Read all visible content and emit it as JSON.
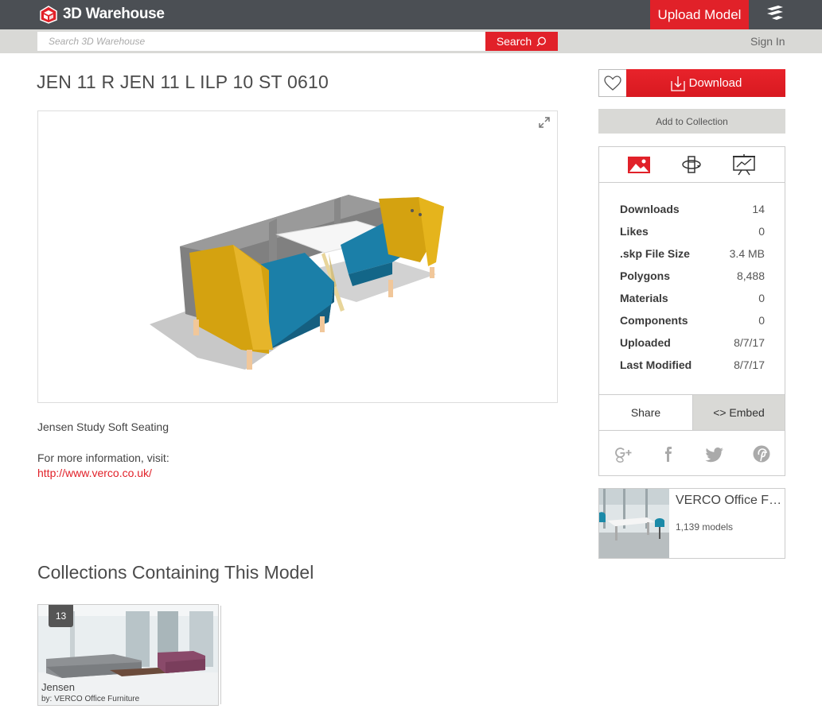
{
  "header": {
    "logo_text": "3D Warehouse",
    "upload_label": "Upload Model",
    "search_placeholder": "Search 3D Warehouse",
    "search_label": "Search",
    "signin_label": "Sign In"
  },
  "model": {
    "title": "JEN 11 R JEN 11 L ILP 10 ST 0610",
    "description": "Jensen Study Soft Seating",
    "more_info": "For more information, visit:",
    "link": "http://www.verco.co.uk/"
  },
  "actions": {
    "download_label": "Download",
    "add_collection_label": "Add to Collection"
  },
  "stats": [
    {
      "label": "Downloads",
      "value": "14"
    },
    {
      "label": "Likes",
      "value": "0"
    },
    {
      "label": ".skp File Size",
      "value": "3.4 MB"
    },
    {
      "label": "Polygons",
      "value": "8,488"
    },
    {
      "label": "Materials",
      "value": "0"
    },
    {
      "label": "Components",
      "value": "0"
    },
    {
      "label": "Uploaded",
      "value": "8/7/17"
    },
    {
      "label": "Last Modified",
      "value": "8/7/17"
    }
  ],
  "share": {
    "share_label": "Share",
    "embed_label": "<> Embed",
    "icons": [
      "google-plus-icon",
      "facebook-icon",
      "twitter-icon",
      "pinterest-icon"
    ]
  },
  "author": {
    "name": "VERCO Office Fu...",
    "count": "1,139 models"
  },
  "collections": {
    "heading": "Collections Containing This Model",
    "items": [
      {
        "badge": "13",
        "name": "Jensen",
        "by": "by: VERCO Office Furniture"
      }
    ]
  },
  "colors": {
    "brand_red": "#e12129",
    "topbar": "#4b4f54",
    "subbar": "#d9d9d6"
  }
}
